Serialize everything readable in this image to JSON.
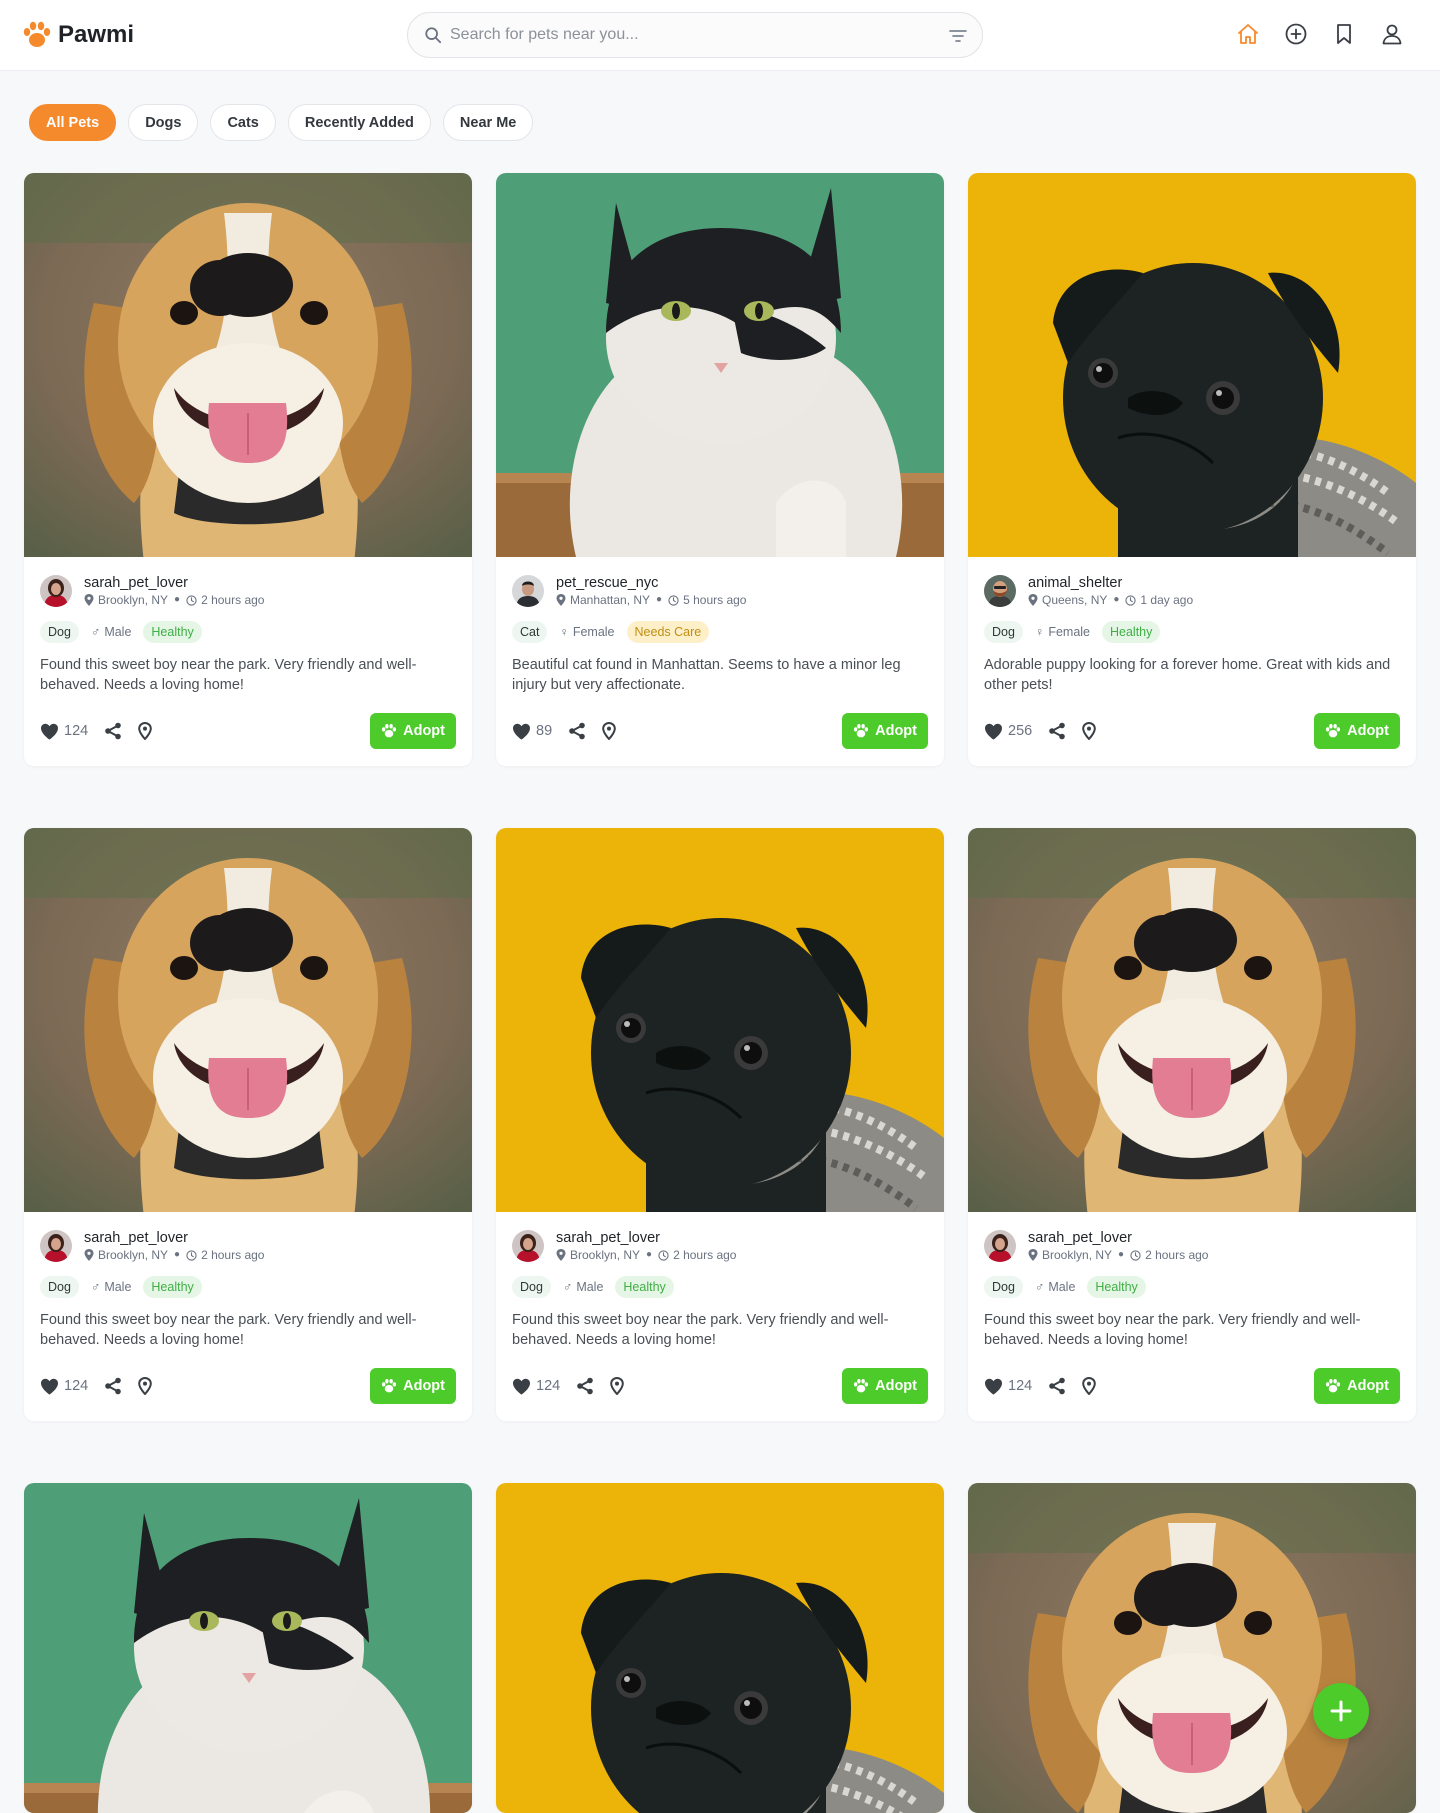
{
  "app": {
    "name": "Pawmi",
    "brand_color": "#f58a2d",
    "accent_green": "#4ccb2a"
  },
  "search": {
    "placeholder": "Search for pets near you..."
  },
  "nav": [
    "home-icon",
    "add-icon",
    "bookmark-icon",
    "user-icon"
  ],
  "filters": [
    "All Pets",
    "Dogs",
    "Cats",
    "Recently Added",
    "Near Me"
  ],
  "adopt_label": "Adopt",
  "posts": [
    {
      "photo": "beagle",
      "avatar": "woman",
      "username": "sarah_pet_lover",
      "location": "Brooklyn, NY",
      "time": "2 hours ago",
      "species": "Dog",
      "gender": "Male",
      "status": "Healthy",
      "status_type": "healthy",
      "description": "Found this sweet boy near the park. Very friendly and well-behaved. Needs a loving home!",
      "likes": "124"
    },
    {
      "photo": "cat",
      "avatar": "man",
      "username": "pet_rescue_nyc",
      "location": "Manhattan, NY",
      "time": "5 hours ago",
      "species": "Cat",
      "gender": "Female",
      "status": "Needs Care",
      "status_type": "care",
      "description": "Beautiful cat found in Manhattan. Seems to have a minor leg injury but very affectionate.",
      "likes": "89"
    },
    {
      "photo": "pug",
      "avatar": "bearded",
      "username": "animal_shelter",
      "location": "Queens, NY",
      "time": "1 day ago",
      "species": "Dog",
      "gender": "Female",
      "status": "Healthy",
      "status_type": "healthy",
      "description": "Adorable puppy looking for a forever home. Great with kids and other pets!",
      "likes": "256"
    },
    {
      "photo": "beagle",
      "avatar": "woman",
      "username": "sarah_pet_lover",
      "location": "Brooklyn, NY",
      "time": "2 hours ago",
      "species": "Dog",
      "gender": "Male",
      "status": "Healthy",
      "status_type": "healthy",
      "description": "Found this sweet boy near the park. Very friendly and well-behaved. Needs a loving home!",
      "likes": "124"
    },
    {
      "photo": "pug",
      "avatar": "woman",
      "username": "sarah_pet_lover",
      "location": "Brooklyn, NY",
      "time": "2 hours ago",
      "species": "Dog",
      "gender": "Male",
      "status": "Healthy",
      "status_type": "healthy",
      "description": "Found this sweet boy near the park. Very friendly and well-behaved. Needs a loving home!",
      "likes": "124"
    },
    {
      "photo": "beagle",
      "avatar": "woman",
      "username": "sarah_pet_lover",
      "location": "Brooklyn, NY",
      "time": "2 hours ago",
      "species": "Dog",
      "gender": "Male",
      "status": "Healthy",
      "status_type": "healthy",
      "description": "Found this sweet boy near the park. Very friendly and well-behaved. Needs a loving home!",
      "likes": "124"
    },
    {
      "photo": "cat"
    },
    {
      "photo": "pug"
    },
    {
      "photo": "beagle"
    }
  ],
  "fab": "plus-icon"
}
